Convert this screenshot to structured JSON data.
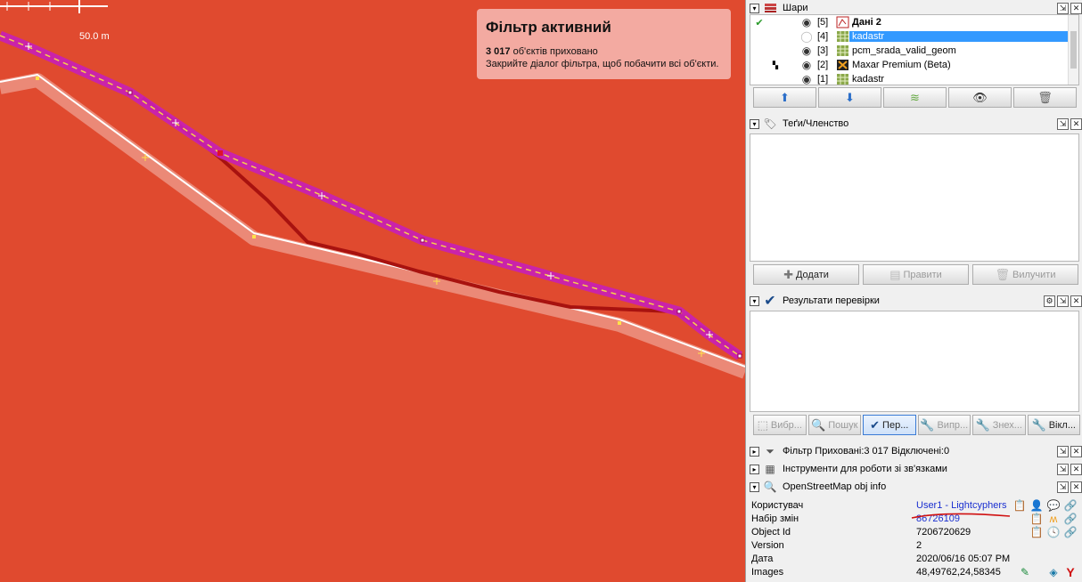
{
  "map": {
    "scale_label": "50.0 m",
    "toast": {
      "title": "Фільтр активний",
      "count": "3 017",
      "hidden_text": " об'єктів приховано",
      "hint": "Закрийте діалог фільтра, щоб побачити всі об'єкти."
    },
    "colors": {
      "background": "#e04a2f",
      "selected_way": "#c81fb4",
      "way_dash": "#f5d24a",
      "white_way": "#ffffff",
      "dark_trace": "#a8120f"
    }
  },
  "layers_panel": {
    "title": "Шари",
    "layers": [
      {
        "index": "[5]",
        "name": "Дані 2",
        "icon": "data-layer-icon",
        "active": true,
        "visible": true,
        "bold": true
      },
      {
        "index": "[4]",
        "name": "kadastr",
        "icon": "tms-layer-icon",
        "selected": true,
        "visible": false
      },
      {
        "index": "[3]",
        "name": "pcm_srada_valid_geom",
        "icon": "tms-layer-icon",
        "visible": true
      },
      {
        "index": "[2]",
        "name": "Maxar Premium (Beta)",
        "icon": "maxar-icon",
        "visible": true
      },
      {
        "index": "[1]",
        "name": "kadastr",
        "icon": "tms-layer-icon",
        "visible": true
      }
    ]
  },
  "tags_panel": {
    "title": "Теґи/Членство",
    "buttons": {
      "add": "Додати",
      "edit": "Правити",
      "delete": "Вилучити"
    }
  },
  "validation_panel": {
    "title": "Результати перевірки",
    "buttons": {
      "select": "Вибр...",
      "lookup": "Пошук",
      "fix_check": "Пер...",
      "fix": "Випр...",
      "ignore": "Знех...",
      "turn_off": "Вікл..."
    }
  },
  "filter_panel": {
    "title": "Фільтр Приховані:3 017 Відключені:0"
  },
  "relations_panel": {
    "title": "Інструменти для роботи зі зв'язками"
  },
  "osm_info_panel": {
    "title": "OpenStreetMap obj info",
    "rows": [
      {
        "key": "Користувач",
        "value": "User1 - Lightcyphers",
        "link": true
      },
      {
        "key": "Набір змін",
        "value": "86726109",
        "link": true
      },
      {
        "key": "Object Id",
        "value": "7206720629"
      },
      {
        "key": "Version",
        "value": "2"
      },
      {
        "key": "Дата",
        "value": "2020/06/16 05:07 PM"
      },
      {
        "key": "Images",
        "value": "48,49762,24,58345"
      }
    ]
  }
}
